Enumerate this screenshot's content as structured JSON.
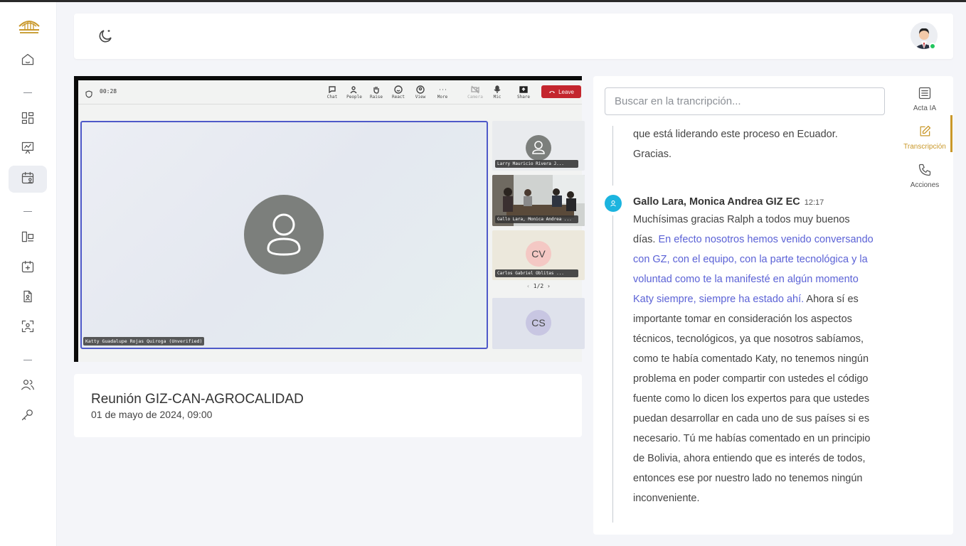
{
  "header": {
    "theme_icon": "moon-icon"
  },
  "sidebar": {
    "items": [
      {
        "icon": "home-icon"
      },
      {
        "icon": "dashboard-grid-icon"
      },
      {
        "icon": "presentation-chart-icon"
      },
      {
        "icon": "calendar-user-icon",
        "active": true
      },
      {
        "icon": "layout-icon"
      },
      {
        "icon": "calendar-add-icon"
      },
      {
        "icon": "document-user-icon"
      },
      {
        "icon": "scan-user-icon"
      },
      {
        "icon": "users-icon"
      },
      {
        "icon": "key-icon"
      }
    ]
  },
  "video": {
    "timer": "00:28",
    "toolbar": {
      "chat": "Chat",
      "people": "People",
      "raise": "Raise",
      "react": "React",
      "view": "View",
      "more": "More",
      "camera": "Camera",
      "mic": "Mic",
      "share": "Share",
      "leave": "Leave"
    },
    "main_participant": "Katty Guadalupe Rojas Quiroga (Unverified)",
    "participants": [
      {
        "name": "Larry Mauricio Rivera J..."
      },
      {
        "name": "Gallo Lara, Monica Andrea ..."
      },
      {
        "name": "Carlos Gabriel Oblitas ...",
        "initials": "CV"
      },
      {
        "name": "",
        "initials": "CS"
      }
    ],
    "pager": "1/2"
  },
  "meeting": {
    "title": "Reunión GIZ-CAN-AGROCALIDAD",
    "date": "01 de mayo de 2024, 09:00"
  },
  "transcript": {
    "search_placeholder": "Buscar en la trancripción...",
    "prev_text": "que está liderando este proceso en Ecuador. Gracias.",
    "speaker": "Gallo Lara, Monica Andrea GIZ EC",
    "time": "12:17",
    "text_intro": "Muchísimas gracias Ralph a todos muy buenos días.",
    "text_highlight": "En efecto nosotros hemos venido conversando con GZ, con el equipo, con la parte tecnológica y la voluntad como te la manifesté en algún momento Katy siempre, siempre ha estado ahí.",
    "text_rest": "Ahora sí es importante tomar en consideración los aspectos técnicos, tecnológicos, ya que nosotros sabíamos, como te había comentado Katy, no tenemos ningún problema en poder compartir con ustedes el código fuente como lo dicen los expertos para que ustedes puedan desarrollar en cada uno de sus países si es necesario. Tú me habías comentado en un principio de Bolivia, ahora entiendo que es interés de todos, entonces ese por nuestro lado no tenemos ningún inconveniente."
  },
  "right_tabs": [
    {
      "label": "Acta IA",
      "icon": "document-lines-icon"
    },
    {
      "label": "Transcripción",
      "icon": "edit-icon",
      "active": true
    },
    {
      "label": "Acciones",
      "icon": "phone-icon"
    }
  ],
  "colors": {
    "accent": "#c9982a",
    "highlight_text": "#5b62d6",
    "leave_button": "#c4262e",
    "speaker_badge": "#1cb4df",
    "online_status": "#22c55e"
  }
}
